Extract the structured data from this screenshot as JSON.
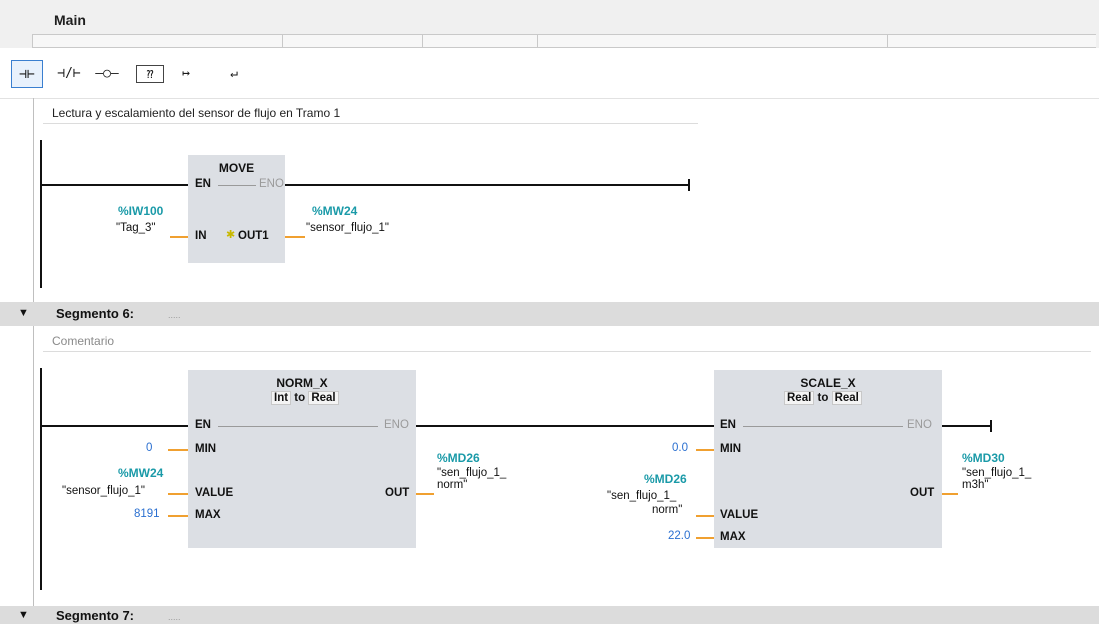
{
  "header": {
    "title": "Main"
  },
  "toolbar": {
    "buttons": [
      {
        "label": "⊣⊢",
        "icon": "normally-open-contact-icon"
      },
      {
        "label": "⊣/⊢",
        "icon": "normally-closed-contact-icon"
      },
      {
        "label": "–○–",
        "icon": "coil-icon"
      },
      {
        "label": "⁇",
        "icon": "empty-box-icon"
      },
      {
        "label": "↦",
        "icon": "open-branch-icon"
      },
      {
        "label": "↵",
        "icon": "close-branch-icon"
      }
    ]
  },
  "network5": {
    "comment": "Lectura y escalamiento del sensor de flujo en Tramo 1",
    "move": {
      "title": "MOVE",
      "en": "EN",
      "eno": "ENO",
      "in_pin": "IN",
      "out_pin": "OUT1",
      "in_addr": "%IW100",
      "in_tag": "\"Tag_3\"",
      "out_addr": "%MW24",
      "out_tag": "\"sensor_flujo_1\""
    }
  },
  "segment6": {
    "arrow": "▼",
    "title": "Segmento 6:",
    "dots": ".....",
    "comment": "Comentario",
    "norm": {
      "title": "NORM_X",
      "from": "Int",
      "to_word": "to",
      "to": "Real",
      "en": "EN",
      "eno": "ENO",
      "min_pin": "MIN",
      "value_pin": "VALUE",
      "max_pin": "MAX",
      "out_pin": "OUT",
      "min_val": "0",
      "value_addr": "%MW24",
      "value_tag": "\"sensor_flujo_1\"",
      "max_val": "8191",
      "out_addr": "%MD26",
      "out_tag_1": "\"sen_flujo_1_",
      "out_tag_2": "norm\""
    },
    "scale": {
      "title": "SCALE_X",
      "from": "Real",
      "to_word": "to",
      "to": "Real",
      "en": "EN",
      "eno": "ENO",
      "min_pin": "MIN",
      "value_pin": "VALUE",
      "max_pin": "MAX",
      "out_pin": "OUT",
      "min_val": "0.0",
      "value_addr": "%MD26",
      "value_tag_1": "\"sen_flujo_1_",
      "value_tag_2": "norm\"",
      "max_val": "22.0",
      "out_addr": "%MD30",
      "out_tag_1": "\"sen_flujo_1_",
      "out_tag_2": "m3h\""
    }
  },
  "segment7": {
    "arrow": "▼",
    "title": "Segmento 7:",
    "dots": "....."
  },
  "colors": {
    "address": "#1a9aa8",
    "wire": "#f0a030",
    "constant": "#2a6fd0",
    "block": "#dcdfe4",
    "segment_bar": "#dcdcdc"
  }
}
